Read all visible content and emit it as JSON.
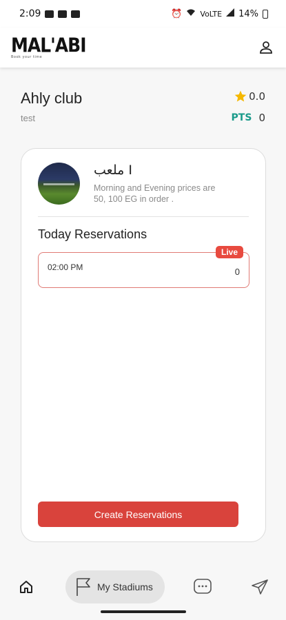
{
  "status_bar": {
    "time": "2:09",
    "network": "VoLTE",
    "battery": "14%"
  },
  "header": {
    "logo_text": "MAL'ABI",
    "logo_tagline": "Book your time"
  },
  "club": {
    "name": "Ahly club",
    "subtitle": "test",
    "rating": "0.0",
    "pts_label": "PTS",
    "pts_value": "0"
  },
  "stadium": {
    "name": "ملعب I",
    "description": "Morning and Evening prices are 50, 100 EG in order ."
  },
  "reservations": {
    "title": "Today Reservations",
    "items": [
      {
        "time": "02:00 PM",
        "count": "0",
        "badge": "Live"
      }
    ]
  },
  "actions": {
    "create_label": "Create Reservations"
  },
  "bottom_nav": {
    "stadiums_label": "My Stadiums"
  },
  "colors": {
    "accent_red": "#d9433c",
    "live_red": "#e84a3f",
    "pts_teal": "#1a9a8a",
    "star_yellow": "#f5b800"
  },
  "icons": [
    "home-icon",
    "flag-icon",
    "chat-icon",
    "send-icon",
    "user-icon",
    "star-icon"
  ]
}
